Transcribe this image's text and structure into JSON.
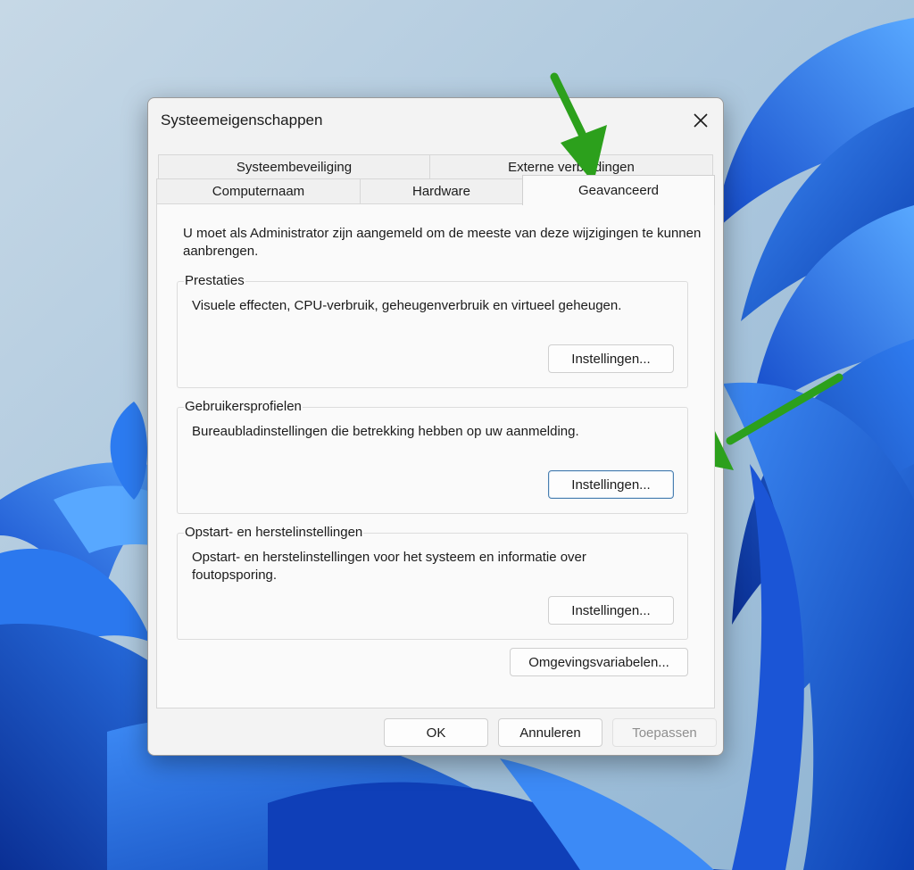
{
  "dialog": {
    "title": "Systeemeigenschappen",
    "tabs_back": [
      {
        "label": "Systeembeveiliging"
      },
      {
        "label": "Externe verbindingen"
      }
    ],
    "tabs_front": [
      {
        "label": "Computernaam"
      },
      {
        "label": "Hardware"
      },
      {
        "label": "Geavanceerd",
        "active": true
      }
    ],
    "intro": "U moet als Administrator zijn aangemeld om de meeste van deze wijzigingen te kunnen aanbrengen.",
    "groups": [
      {
        "legend": "Prestaties",
        "description": "Visuele effecten, CPU-verbruik, geheugenverbruik en virtueel geheugen.",
        "button": "Instellingen..."
      },
      {
        "legend": "Gebruikersprofielen",
        "description": "Bureaubladinstellingen die betrekking hebben op uw aanmelding.",
        "button": "Instellingen..."
      },
      {
        "legend": "Opstart- en herstelinstellingen",
        "description": "Opstart- en herstelinstellingen voor het systeem en informatie over foutopsporing.",
        "button": "Instellingen..."
      }
    ],
    "env_button": "Omgevingsvariabelen...",
    "footer": {
      "ok": "OK",
      "cancel": "Annuleren",
      "apply": "Toepassen"
    }
  },
  "colors": {
    "annotation_arrow": "#2ca01c",
    "focus_border": "#4a7fb0",
    "wallpaper_blue": "#1e62e0"
  },
  "icons": {
    "close": "close-icon",
    "annotation": "arrow-annotation"
  }
}
